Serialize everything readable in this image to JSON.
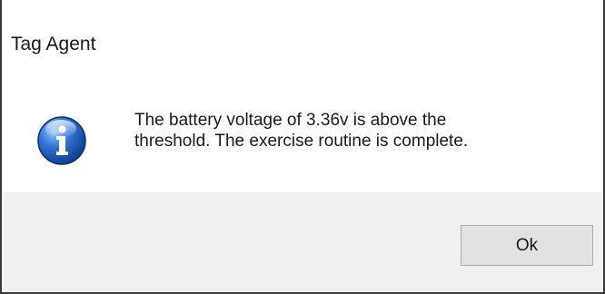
{
  "dialog": {
    "title": "Tag Agent",
    "message": "The battery voltage of 3.36v is above the\nthreshold. The exercise routine is complete.",
    "icon": "info-icon",
    "ok_label": "Ok"
  },
  "colors": {
    "icon_blue": "#1f5fbf",
    "button_bg": "#e1e1e1",
    "footer_bg": "#f0f0f0"
  }
}
